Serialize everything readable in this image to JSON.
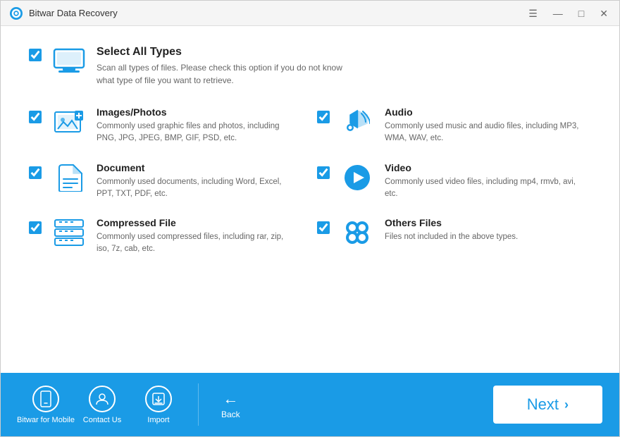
{
  "titleBar": {
    "title": "Bitwar Data Recovery",
    "controls": {
      "menu": "☰",
      "minimize": "—",
      "maximize": "□",
      "close": "✕"
    }
  },
  "selectAll": {
    "checked": true,
    "label": "Select All Types",
    "description": "Scan all types of files. Please check this option if you do not know what type of file you want to retrieve."
  },
  "fileTypes": [
    {
      "id": "images",
      "checked": true,
      "label": "Images/Photos",
      "description": "Commonly used graphic files and photos, including PNG, JPG, JPEG, BMP, GIF, PSD, etc."
    },
    {
      "id": "audio",
      "checked": true,
      "label": "Audio",
      "description": "Commonly used music and audio files, including MP3, WMA, WAV, etc."
    },
    {
      "id": "document",
      "checked": true,
      "label": "Document",
      "description": "Commonly used documents, including Word, Excel, PPT, TXT, PDF, etc."
    },
    {
      "id": "video",
      "checked": true,
      "label": "Video",
      "description": "Commonly used video files, including mp4, rmvb, avi, etc."
    },
    {
      "id": "compressed",
      "checked": true,
      "label": "Compressed File",
      "description": "Commonly used compressed files, including rar, zip, iso, 7z, cab, etc."
    },
    {
      "id": "others",
      "checked": true,
      "label": "Others Files",
      "description": "Files not included in the above types."
    }
  ],
  "bottomBar": {
    "actions": [
      {
        "id": "mobile",
        "label": "Bitwar for Mobile"
      },
      {
        "id": "contact",
        "label": "Contact Us"
      },
      {
        "id": "import",
        "label": "Import"
      }
    ],
    "back": "Back",
    "next": "Next"
  }
}
